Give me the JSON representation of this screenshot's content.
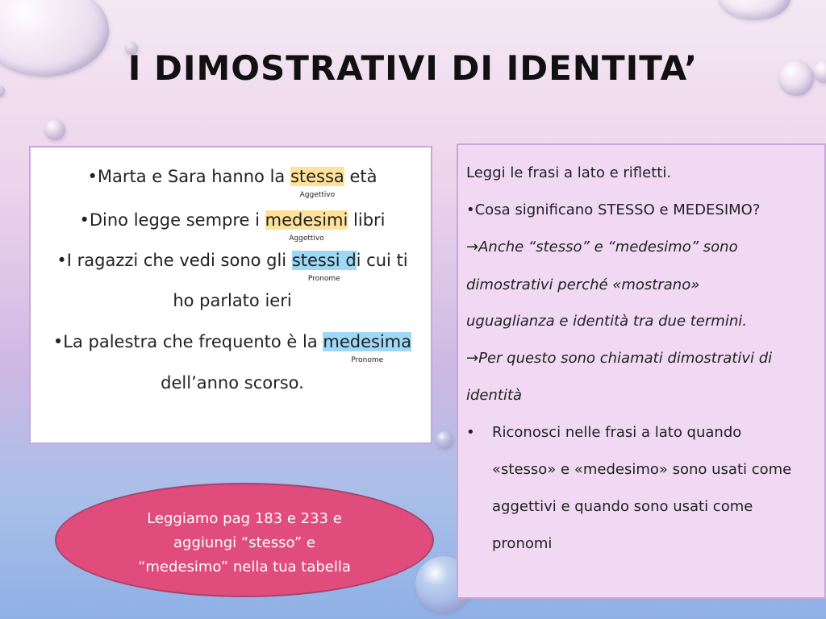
{
  "title": "I DIMOSTRATIVI DI IDENTITA’",
  "left_panel": {
    "line1": {
      "pre": "•Marta e Sara hanno la ",
      "hl": "stessa",
      "post": " età",
      "tag": "Aggettivo"
    },
    "line2": {
      "pre": "•Dino legge sempre i ",
      "hl": "medesimi",
      "post": " libri",
      "tag": "Aggettivo"
    },
    "line3": {
      "pre": "•I ragazzi che vedi sono gli ",
      "hl": "stessi d",
      "post": "i cui ti",
      "tag": "Pronome"
    },
    "line4": "ho parlato ieri",
    "line5": {
      "pre": "•La palestra che frequento è la ",
      "hl": "medesima",
      "post": "",
      "tag": "Pronome"
    },
    "line6": "dell’anno scorso.",
    "colors": {
      "aggettivo_highlight": "#ffe19a",
      "pronome_highlight": "#9ed8f5"
    }
  },
  "right_panel": {
    "p1": "Leggi le frasi a lato e rifletti.",
    "p2": "•Cosa significano STESSO e MEDESIMO?",
    "p3_arrow": "→",
    "p3a": "Anche “stesso” e “medesimo” sono",
    "p3b": "dimostrativi perché «mostrano»",
    "p3c": "uguaglianza e identità tra due termini.",
    "p4_arrow": "→",
    "p4a": "Per questo sono chiamati dimostrativi di",
    "p4b": "identità",
    "bullet": "•",
    "b1": "Riconosci nelle frasi a lato quando",
    "b2": "«stesso» e «medesimo» sono usati come",
    "b3": "aggettivi e quando sono usati come",
    "b4": "pronomi"
  },
  "ellipse": {
    "l1": "Leggiamo pag 183 e 233 e",
    "l2": "aggiungi “stesso” e",
    "l3": "“medesimo” nella tua tabella",
    "color": "#e04c7c"
  }
}
